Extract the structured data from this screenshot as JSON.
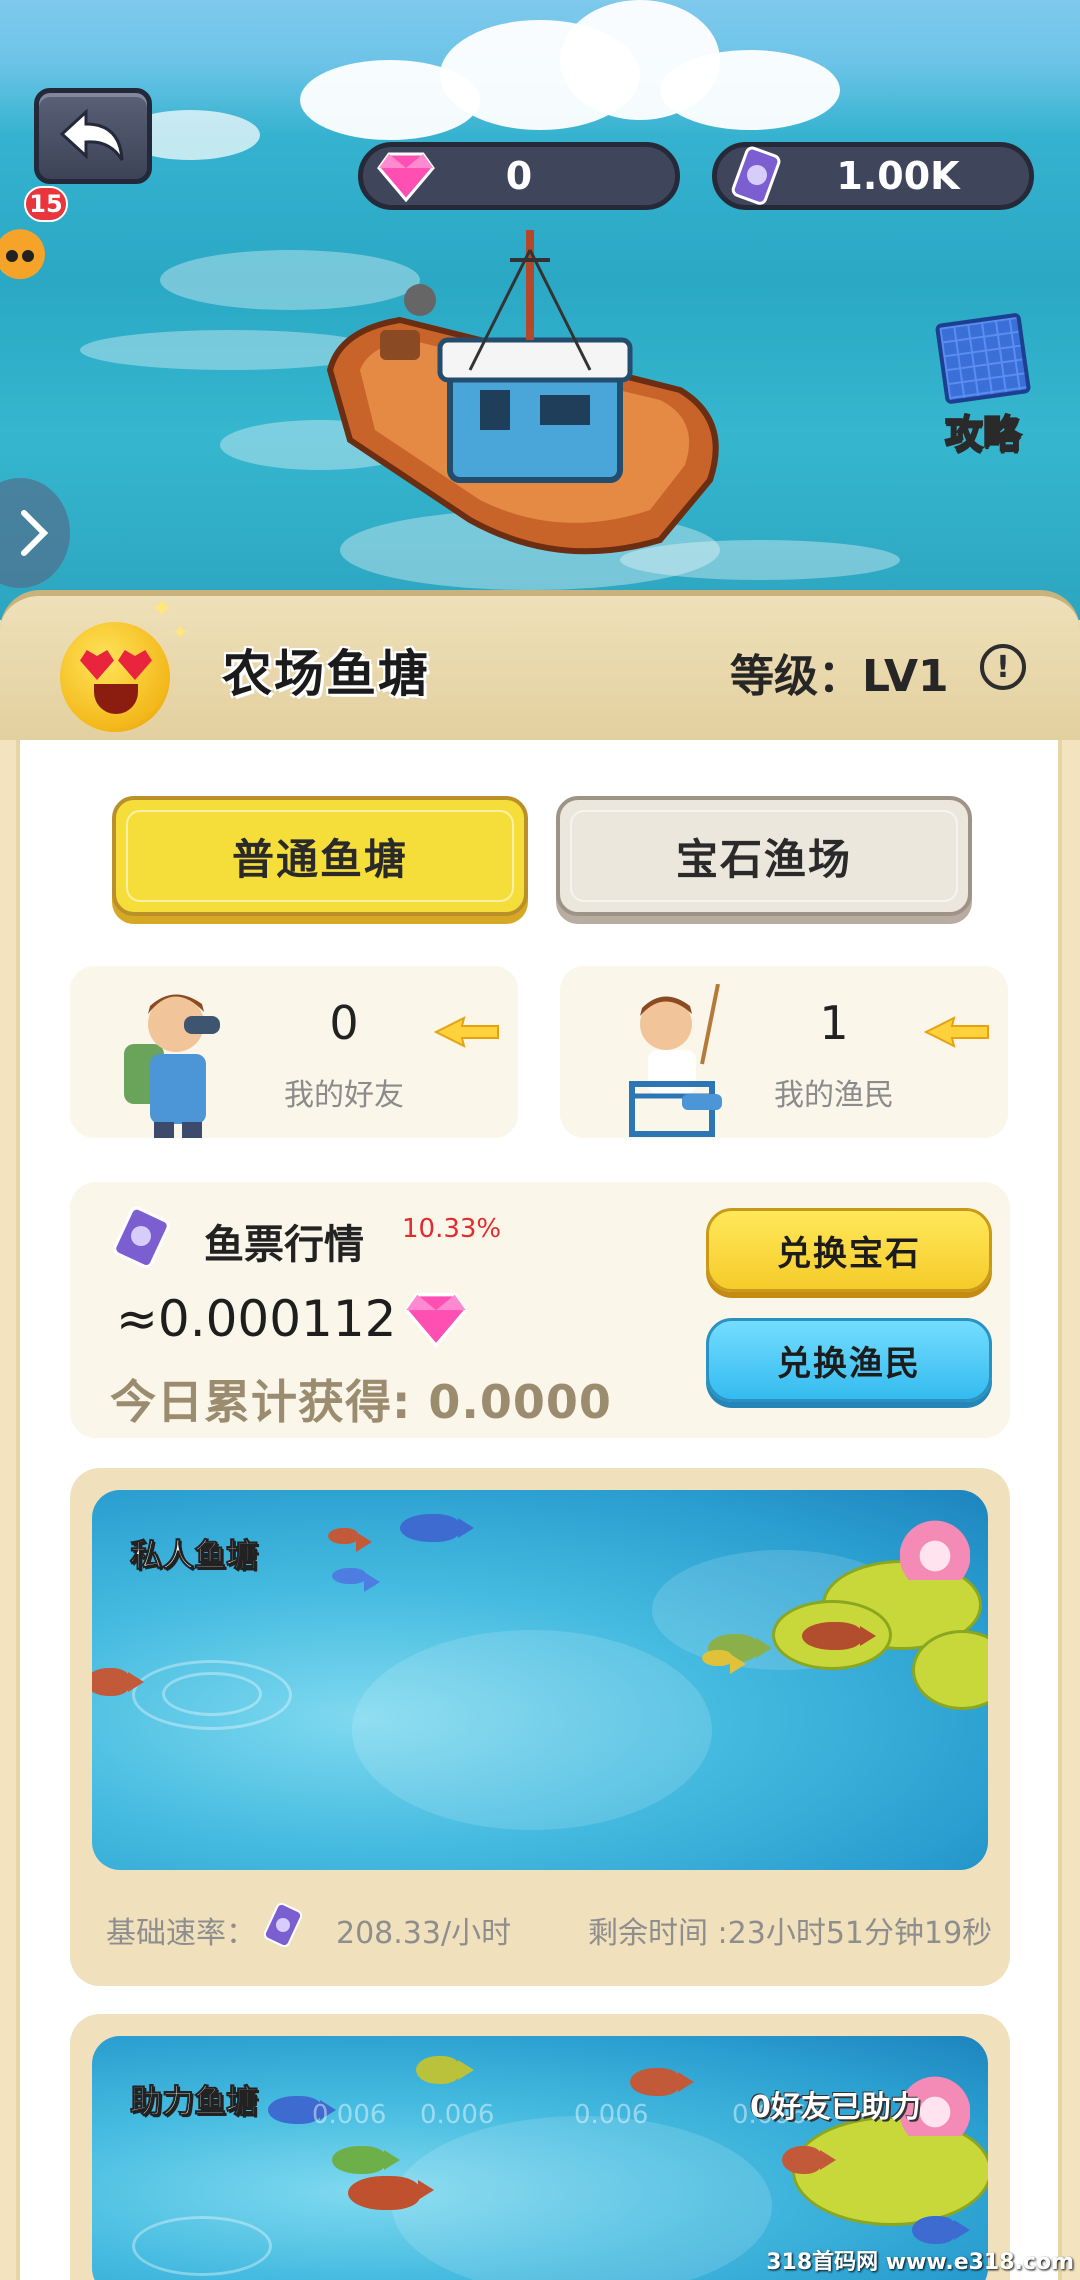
{
  "hud": {
    "gems": "0",
    "tickets": "1.00K",
    "notification_count": "15",
    "strategy_label": "攻略"
  },
  "pond": {
    "title": "农场鱼塘",
    "level": "等级：LV1"
  },
  "tabs": [
    {
      "label": "普通鱼塘",
      "active": true
    },
    {
      "label": "宝石渔场",
      "active": false
    }
  ],
  "stats": {
    "friends": {
      "value": "0",
      "label": "我的好友"
    },
    "fishers": {
      "value": "1",
      "label": "我的渔民"
    }
  },
  "market": {
    "title": "鱼票行情",
    "change": "10.33%",
    "rate": "≈0.000112",
    "today_total": "今日累计获得: 0.0000",
    "exchange_gem": "兑换宝石",
    "exchange_fisher": "兑换渔民"
  },
  "private_pond": {
    "caption": "私人鱼塘",
    "base_rate_label": "基础速率：",
    "base_rate_value": "208.33/小时",
    "remaining": "剩余时间 :23小时51分钟19秒"
  },
  "help_pond": {
    "caption": "助力鱼塘",
    "status": "0好友已助力",
    "slot_values": [
      "0.006",
      "0.006",
      "0.006",
      "0.006"
    ]
  },
  "watermark": "318首码网 www.e318.com",
  "colors": {
    "accent_yellow": "#f6de3a",
    "accent_blue": "#34bbef",
    "change_red": "#e22b2b",
    "panel_beige": "#f0e1bc"
  }
}
